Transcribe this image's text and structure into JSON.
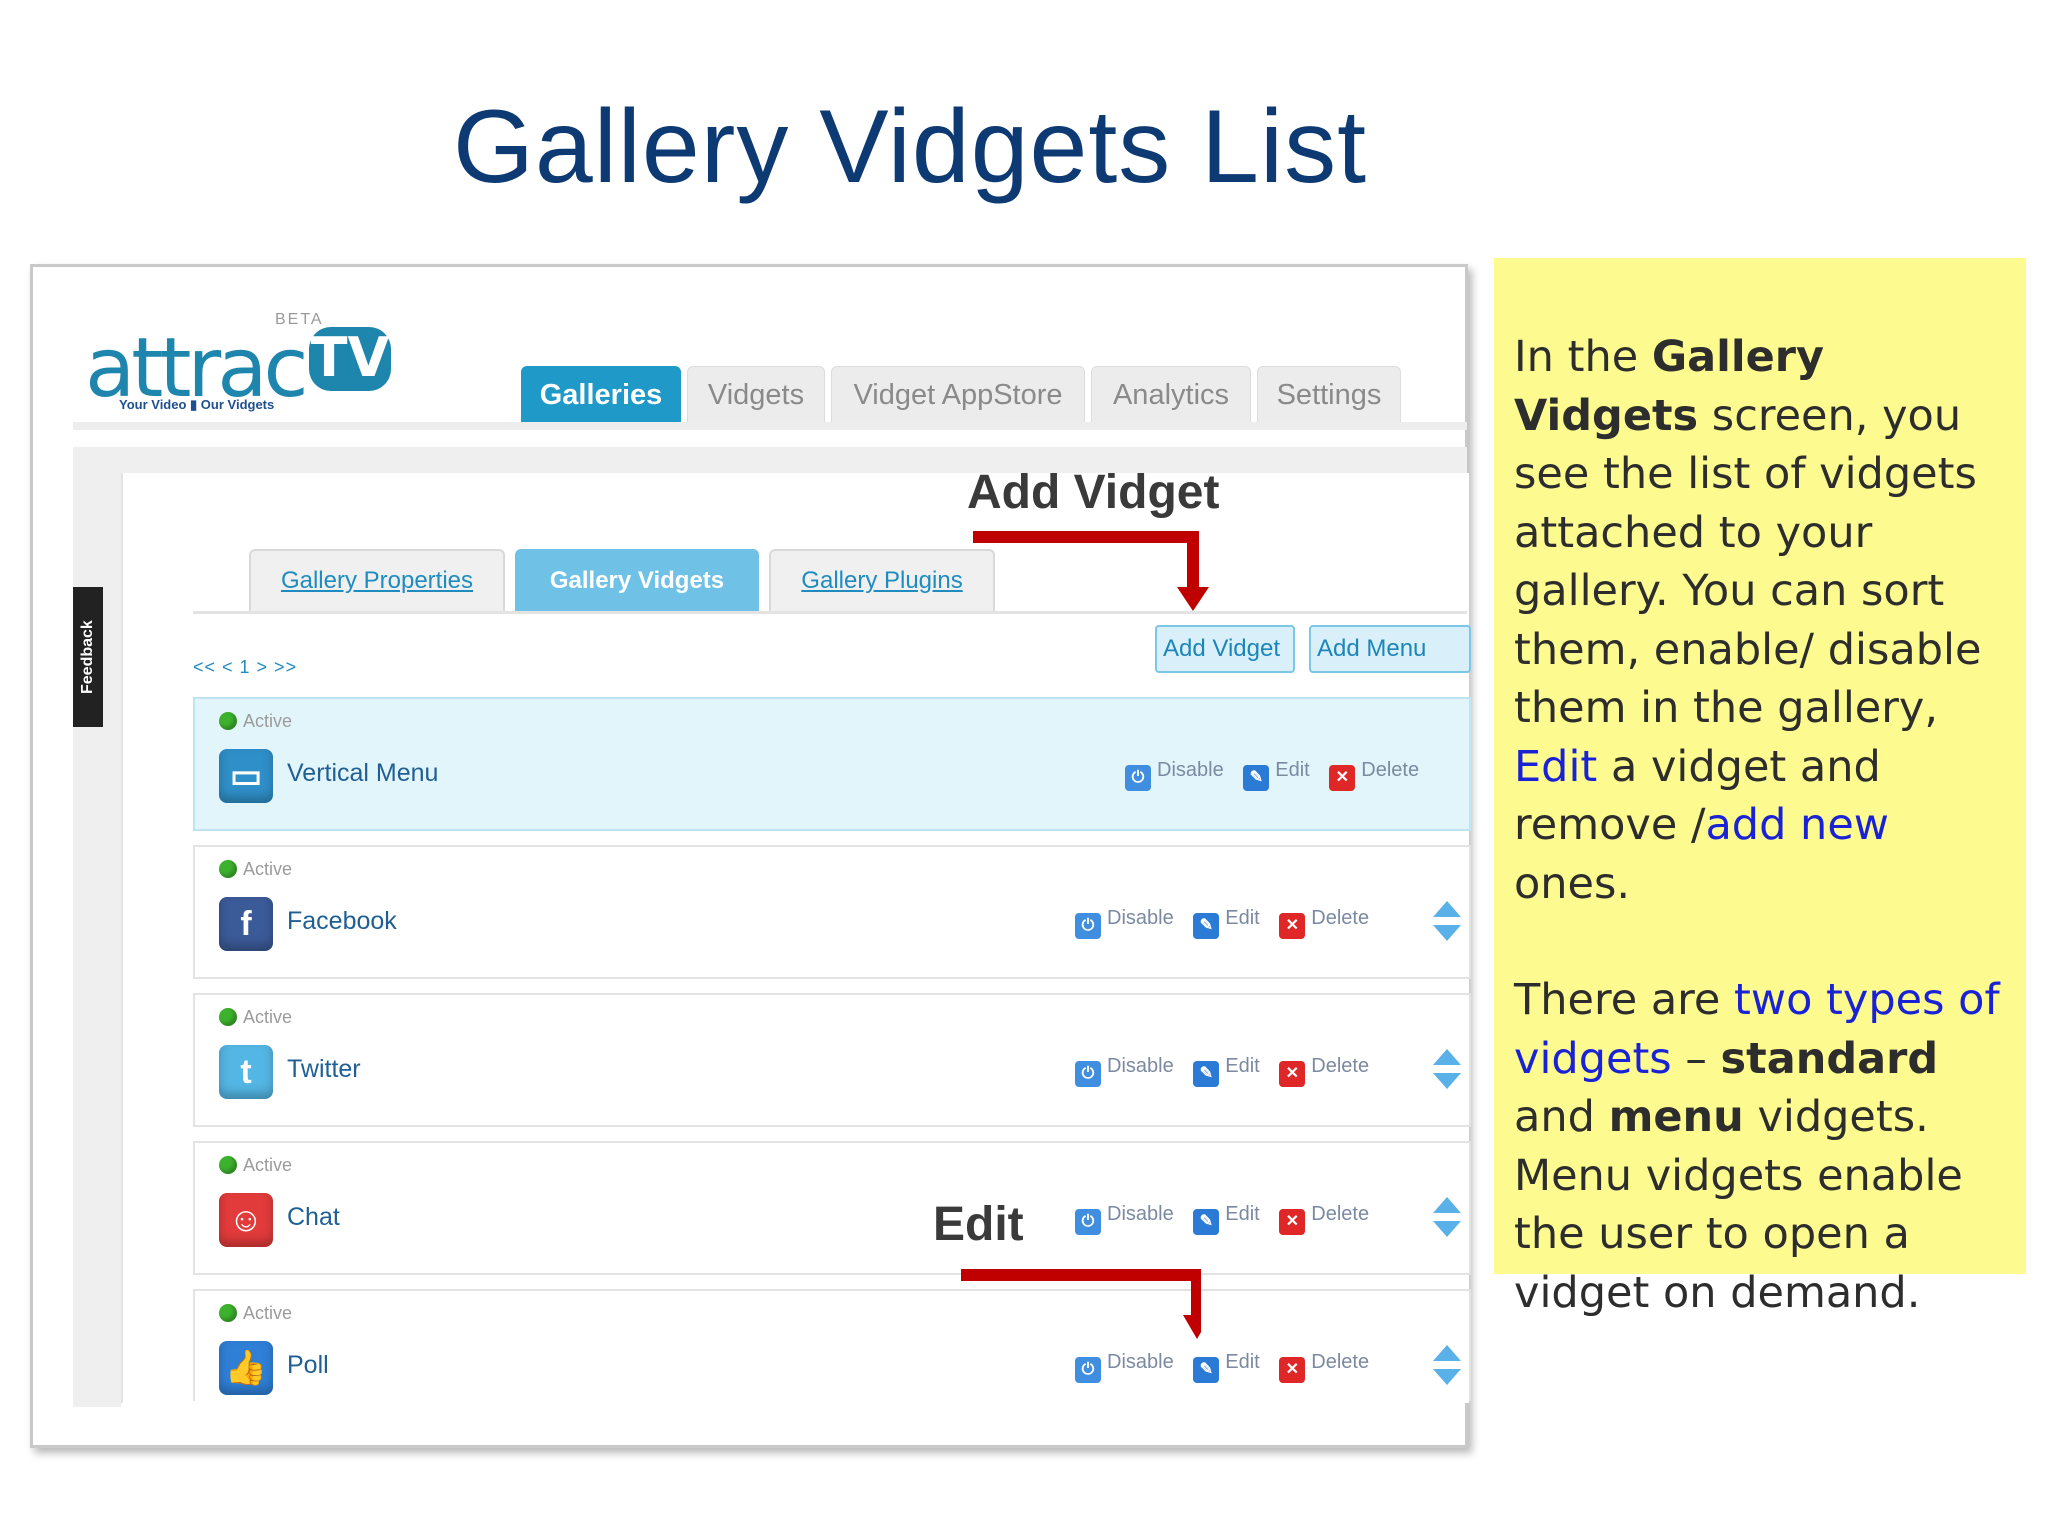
{
  "slide": {
    "title": "Gallery Vidgets List"
  },
  "app": {
    "logo": {
      "brand": "attrac",
      "tv": "TV",
      "beta": "BETA",
      "tagline": "Your Video ▮ Our Vidgets"
    },
    "top_tabs": [
      {
        "label": "Galleries",
        "active": true
      },
      {
        "label": "Vidgets",
        "active": false
      },
      {
        "label": "Vidget AppStore",
        "active": false
      },
      {
        "label": "Analytics",
        "active": false
      },
      {
        "label": "Settings",
        "active": false
      }
    ],
    "feedback_label": "Feedback",
    "sub_tabs": [
      {
        "label": "Gallery Properties",
        "active": false
      },
      {
        "label": "Gallery Vidgets",
        "active": true
      },
      {
        "label": "Gallery Plugins",
        "active": false
      }
    ],
    "pager": "<< < 1 > >>",
    "buttons": {
      "add_vidget": "Add Vidget",
      "add_menu": "Add Menu"
    },
    "actions": {
      "disable": "Disable",
      "edit": "Edit",
      "delete": "Delete"
    },
    "vidgets": [
      {
        "status": "Active",
        "name": "Vertical Menu",
        "icon": "vertical-menu-icon",
        "color": "#2f8fc8"
      },
      {
        "status": "Active",
        "name": "Facebook",
        "icon": "facebook-icon",
        "color": "#3b5a98"
      },
      {
        "status": "Active",
        "name": "Twitter",
        "icon": "twitter-icon",
        "color": "#54b6e4"
      },
      {
        "status": "Active",
        "name": "Chat",
        "icon": "chat-icon",
        "color": "#e23b3b"
      },
      {
        "status": "Active",
        "name": "Poll",
        "icon": "poll-icon",
        "color": "#2f7fd6"
      }
    ]
  },
  "annotations": {
    "add_vidget": "Add Vidget",
    "edit": "Edit",
    "arrow_color": "#c00000"
  },
  "note": {
    "p1_a": "In the ",
    "p1_b": "Gallery Vidgets",
    "p1_c": " screen, you see the list of vidgets attached to your gallery. You can sort them, enable/ disable them in the gallery, ",
    "p1_link1": "Edit",
    "p1_d": " a vidget and remove /",
    "p1_link2": "add new",
    "p1_e": " ones.",
    "p2_a": "There are ",
    "p2_link": "two types of vidgets",
    "p2_b": " – ",
    "p2_c": "standard",
    "p2_d": " and ",
    "p2_e": "menu",
    "p2_f": " vidgets. Menu vidgets enable the user to open a vidget on demand.",
    "background": "#fdfb8f"
  }
}
